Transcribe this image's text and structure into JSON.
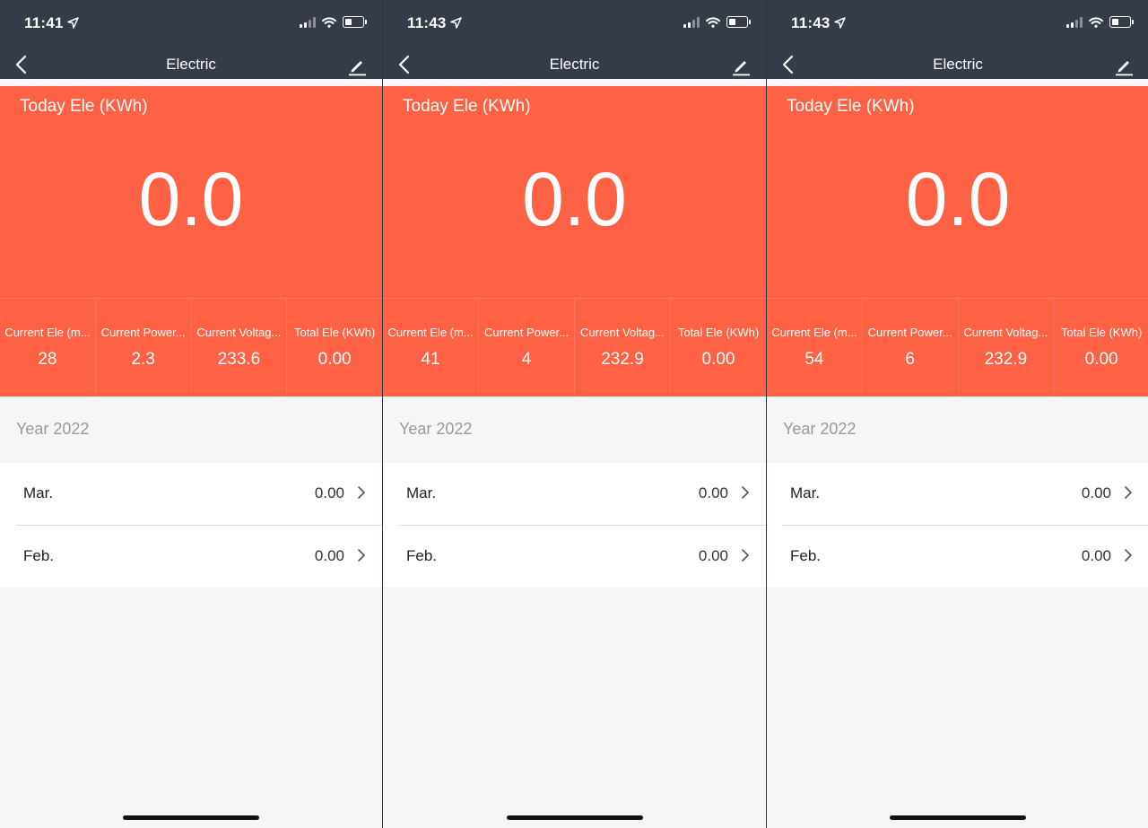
{
  "colors": {
    "header": "#343c4a",
    "card": "#ff6145",
    "background": "#f6f6f6"
  },
  "panels": [
    {
      "time": "11:41",
      "nav_title": "Electric",
      "card_title": "Today Ele (KWh)",
      "today_value": "0.0",
      "stats": [
        {
          "label": "Current Ele (m...",
          "value": "28"
        },
        {
          "label": "Current Power...",
          "value": "2.3"
        },
        {
          "label": "Current Voltag...",
          "value": "233.6"
        },
        {
          "label": "Total Ele (KWh)",
          "value": "0.00"
        }
      ],
      "year_label": "Year 2022",
      "months": [
        {
          "label": "Mar.",
          "value": "0.00"
        },
        {
          "label": "Feb.",
          "value": "0.00"
        }
      ]
    },
    {
      "time": "11:43",
      "nav_title": "Electric",
      "card_title": "Today Ele (KWh)",
      "today_value": "0.0",
      "stats": [
        {
          "label": "Current Ele (m...",
          "value": "41"
        },
        {
          "label": "Current Power...",
          "value": "4"
        },
        {
          "label": "Current Voltag...",
          "value": "232.9"
        },
        {
          "label": "Total Ele (KWh)",
          "value": "0.00"
        }
      ],
      "year_label": "Year 2022",
      "months": [
        {
          "label": "Mar.",
          "value": "0.00"
        },
        {
          "label": "Feb.",
          "value": "0.00"
        }
      ]
    },
    {
      "time": "11:43",
      "nav_title": "Electric",
      "card_title": "Today Ele (KWh)",
      "today_value": "0.0",
      "stats": [
        {
          "label": "Current Ele (m...",
          "value": "54"
        },
        {
          "label": "Current Power...",
          "value": "6"
        },
        {
          "label": "Current Voltag...",
          "value": "232.9"
        },
        {
          "label": "Total Ele (KWh)",
          "value": "0.00"
        }
      ],
      "year_label": "Year 2022",
      "months": [
        {
          "label": "Mar.",
          "value": "0.00"
        },
        {
          "label": "Feb.",
          "value": "0.00"
        }
      ]
    }
  ],
  "icons": [
    "location-arrow-icon",
    "cellular-signal-icon",
    "wifi-icon",
    "battery-icon",
    "chevron-left-icon",
    "pencil-edit-icon",
    "chevron-right-icon"
  ]
}
